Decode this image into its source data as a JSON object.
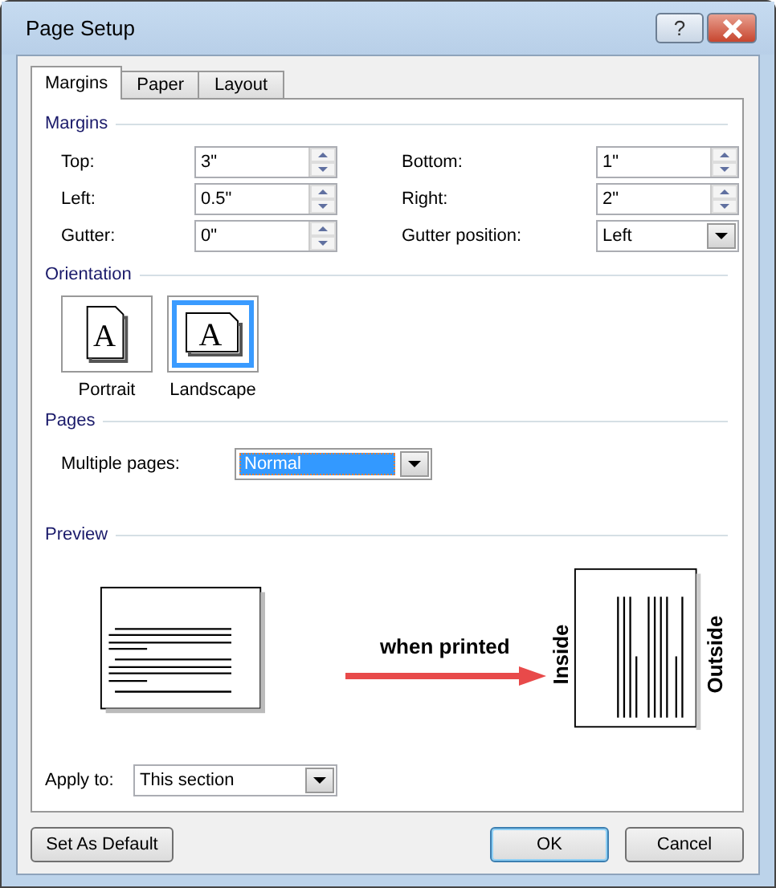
{
  "window": {
    "title": "Page Setup",
    "help_button": "?"
  },
  "tabs": [
    {
      "label": "Margins",
      "selected": true
    },
    {
      "label": "Paper",
      "selected": false
    },
    {
      "label": "Layout",
      "selected": false
    }
  ],
  "margins": {
    "heading": "Margins",
    "fields": [
      {
        "label": "Top:",
        "value": "3\"",
        "kind": "spin"
      },
      {
        "label": "Bottom:",
        "value": "1\"",
        "kind": "spin"
      },
      {
        "label": "Left:",
        "value": "0.5\"",
        "kind": "spin"
      },
      {
        "label": "Right:",
        "value": "2\"",
        "kind": "spin"
      },
      {
        "label": "Gutter:",
        "value": "0\"",
        "kind": "spin"
      },
      {
        "label": "Gutter position:",
        "value": "Left",
        "kind": "dropdown"
      }
    ]
  },
  "orientation": {
    "heading": "Orientation",
    "options": [
      {
        "label": "Portrait",
        "kind": "portrait",
        "icon_text": "A",
        "selected": false
      },
      {
        "label": "Landscape",
        "kind": "landscape",
        "icon_text": "A",
        "selected": true
      }
    ]
  },
  "pages": {
    "heading": "Pages",
    "label": "Multiple pages:",
    "value": "Normal"
  },
  "preview": {
    "heading": "Preview",
    "annotation": "when printed",
    "inside_label": "Inside",
    "outside_label": "Outside"
  },
  "apply_to": {
    "label": "Apply to:",
    "value": "This section"
  },
  "buttons": [
    {
      "label": "Set As Default",
      "kind": "secondary"
    },
    {
      "label": "OK",
      "kind": "default"
    },
    {
      "label": "Cancel",
      "kind": "secondary"
    }
  ]
}
